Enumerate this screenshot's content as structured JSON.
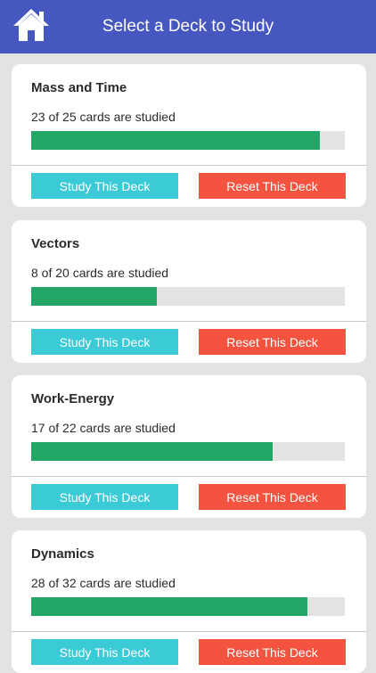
{
  "header": {
    "title": "Select a Deck to Study",
    "home_icon": "home-icon"
  },
  "colors": {
    "header_bg": "#4657bf",
    "progress_fill": "#23a567",
    "progress_track": "#e2e3e3",
    "study_button": "#3bcbd6",
    "reset_button": "#f4533f"
  },
  "decks": [
    {
      "title": "Mass and Time",
      "status": "23 of 25 cards are studied",
      "studied": 23,
      "total": 25,
      "progress_shown": 0.92,
      "study_label": "Study This Deck",
      "reset_label": "Reset This Deck"
    },
    {
      "title": "Vectors",
      "status": "8 of 20 cards are studied",
      "studied": 8,
      "total": 20,
      "progress_shown": 0.4,
      "study_label": "Study This Deck",
      "reset_label": "Reset This Deck"
    },
    {
      "title": "Work-Energy",
      "status": "17 of 22 cards are studied",
      "studied": 17,
      "total": 22,
      "progress_shown": 0.77,
      "study_label": "Study This Deck",
      "reset_label": "Reset This Deck"
    },
    {
      "title": "Dynamics",
      "status": "28 of 32 cards are studied",
      "studied": 28,
      "total": 32,
      "progress_shown": 0.88,
      "study_label": "Study This Deck",
      "reset_label": "Reset This Deck"
    }
  ]
}
